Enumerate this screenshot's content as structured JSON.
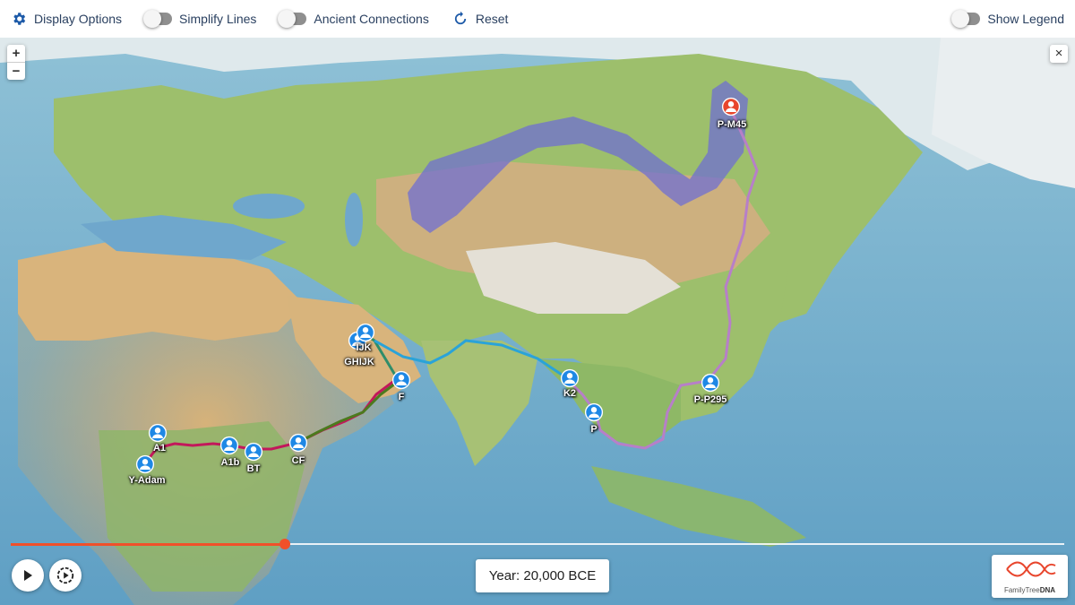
{
  "toolbar": {
    "display_options": "Display Options",
    "simplify_lines": "Simplify Lines",
    "ancient_connections": "Ancient Connections",
    "reset": "Reset",
    "show_legend": "Show Legend"
  },
  "map_controls": {
    "zoom_in": "+",
    "zoom_out": "−",
    "close": "×"
  },
  "markers": [
    {
      "label": "Y-Adam",
      "color": "#1e88e5"
    },
    {
      "label": "A1",
      "color": "#1e88e5"
    },
    {
      "label": "A1b",
      "color": "#1e88e5"
    },
    {
      "label": "BT",
      "color": "#1e88e5"
    },
    {
      "label": "CF",
      "color": "#1e88e5"
    },
    {
      "label": "F",
      "color": "#1e88e5"
    },
    {
      "label": "GHIJK",
      "color": "#1e88e5"
    },
    {
      "label": "IJK",
      "color": "#1e88e5"
    },
    {
      "label": "K2",
      "color": "#1e88e5"
    },
    {
      "label": "P",
      "color": "#1e88e5"
    },
    {
      "label": "P-P295",
      "color": "#1e88e5"
    },
    {
      "label": "P-M45",
      "color": "#e8452c"
    }
  ],
  "timeline": {
    "progress": 0.26,
    "year_text": "Year: 20,000 BCE"
  },
  "logo": {
    "text_plain": "FamilyTree",
    "text_bold": "DNA"
  },
  "colors": {
    "accent": "#f0502a",
    "toolbar_text": "#2a4060",
    "marker": "#1e88e5",
    "route_purple": "#b77fc8",
    "route_blue": "#2aa3d8",
    "route_magenta": "#c2185b",
    "route_green": "#4c7a1e"
  }
}
